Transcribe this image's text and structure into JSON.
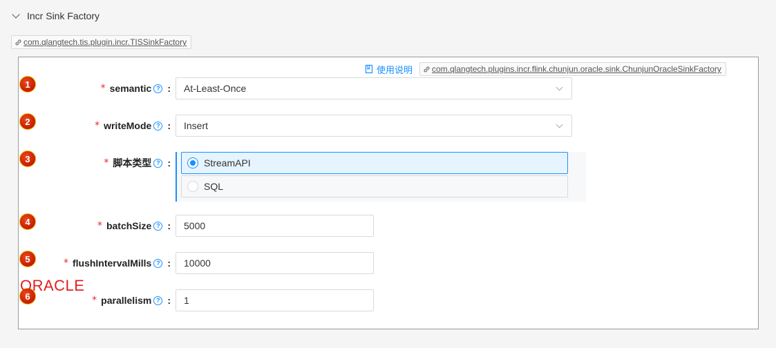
{
  "section": {
    "title": "Incr Sink Factory"
  },
  "plugin_tag": "com.qlangtech.tis.plugin.incr.TISSinkFactory",
  "doc_link": "使用说明",
  "impl_tag": "com.qlangtech.plugins.incr.flink.chunjun.oracle.sink.ChunjunOracleSinkFactory",
  "logo": "ORACLE",
  "fields": [
    {
      "num": "1",
      "label": "semantic",
      "value": "At-Least-Once"
    },
    {
      "num": "2",
      "label": "writeMode",
      "value": "Insert"
    },
    {
      "num": "3",
      "label": "脚本类型",
      "options": [
        "StreamAPI",
        "SQL"
      ]
    },
    {
      "num": "4",
      "label": "batchSize",
      "value": "5000"
    },
    {
      "num": "5",
      "label": "flushIntervalMills",
      "value": "10000"
    },
    {
      "num": "6",
      "label": "parallelism",
      "value": "1"
    }
  ],
  "required_mark": "*",
  "help_glyph": "?",
  "colon": ":",
  "colors": {
    "accent": "#1890ff",
    "required": "#f5222d",
    "badge": "#c41c00",
    "oracle": "#e02020"
  }
}
